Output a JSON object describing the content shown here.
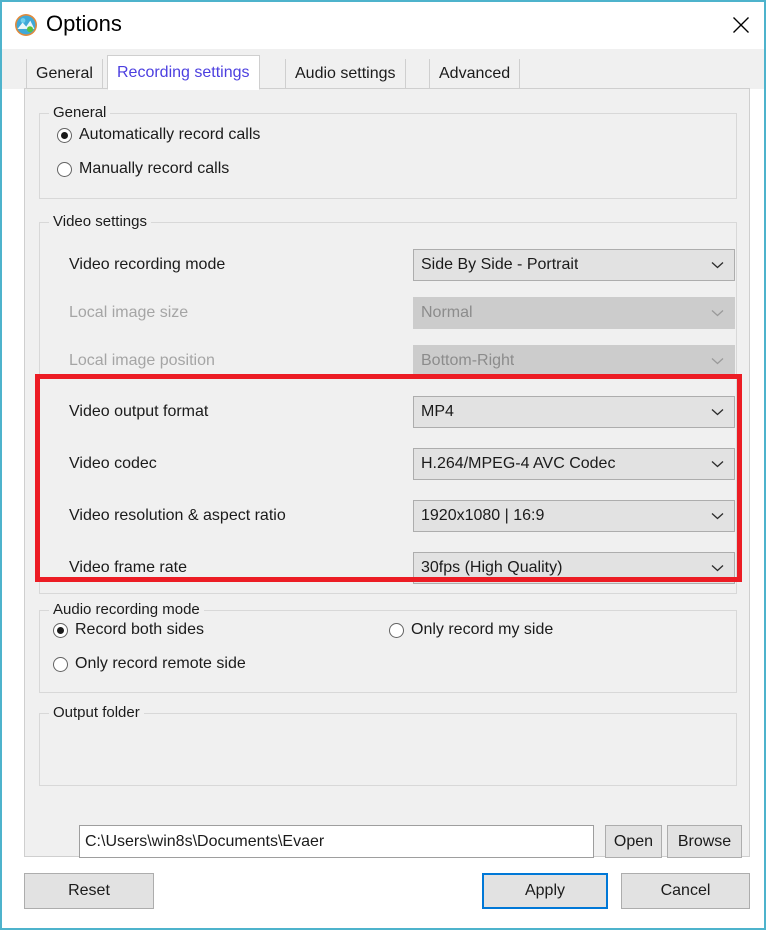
{
  "window": {
    "title": "Options",
    "icon": "app-globe-icon",
    "close_label": "✕",
    "border_color": "#4eb3cc"
  },
  "tabs": [
    {
      "label": "General",
      "selected": false
    },
    {
      "label": "Recording settings",
      "selected": true
    },
    {
      "label": "Audio settings",
      "selected": false
    },
    {
      "label": "Advanced",
      "selected": false
    }
  ],
  "general_group": {
    "title": "General",
    "options": [
      {
        "label": "Automatically record calls",
        "checked": true
      },
      {
        "label": "Manually record calls",
        "checked": false
      }
    ]
  },
  "video_group": {
    "title": "Video settings",
    "fields": [
      {
        "label": "Video recording mode",
        "value": "Side By Side - Portrait",
        "disabled": false,
        "highlighted": false
      },
      {
        "label": "Local image size",
        "value": "Normal",
        "disabled": true,
        "highlighted": false
      },
      {
        "label": "Local image position",
        "value": "Bottom-Right",
        "disabled": true,
        "highlighted": false
      },
      {
        "label": "Video output format",
        "value": "MP4",
        "disabled": false,
        "highlighted": true
      },
      {
        "label": "Video codec",
        "value": "H.264/MPEG-4 AVC Codec",
        "disabled": false,
        "highlighted": true
      },
      {
        "label": "Video resolution & aspect ratio",
        "value": "1920x1080 | 16:9",
        "disabled": false,
        "highlighted": true
      },
      {
        "label": "Video frame rate",
        "value": "30fps (High Quality)",
        "disabled": false,
        "highlighted": true
      }
    ]
  },
  "audio_group": {
    "title": "Audio recording mode",
    "options": [
      {
        "label": "Record both sides",
        "checked": true
      },
      {
        "label": "Only record my side",
        "checked": false
      },
      {
        "label": "Only record remote side",
        "checked": false
      }
    ]
  },
  "output_group": {
    "title": "Output folder",
    "path": "C:\\Users\\win8s\\Documents\\Evaer",
    "open_label": "Open",
    "browse_label": "Browse"
  },
  "footer": {
    "reset_label": "Reset",
    "apply_label": "Apply",
    "cancel_label": "Cancel"
  },
  "annotation": {
    "type": "rectangle-highlight",
    "color": "#ec1c24"
  }
}
